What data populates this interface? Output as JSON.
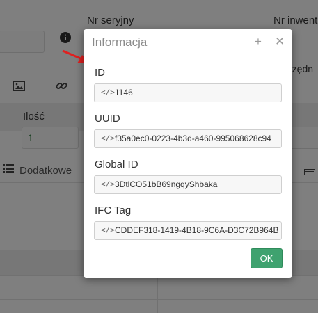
{
  "background": {
    "labels": {
      "serial_number": "Nr seryjny",
      "inventory_number": "Nr inwent",
      "quantity": "Ilość",
      "coordinates_partial": "rzędn",
      "additional": "Dodatkowe"
    },
    "quantity_value": "1"
  },
  "modal": {
    "title": "Informacja",
    "fields": [
      {
        "label": "ID",
        "value": "1146"
      },
      {
        "label": "UUID",
        "value": "f35a0ec0-0223-4b3d-a460-995068628c94"
      },
      {
        "label": "Global ID",
        "value": "3DtlCO51bB69ngqyShbaka"
      },
      {
        "label": "IFC Tag",
        "value": "CDDEF318-1419-4B18-9C6A-D3C72B964B"
      }
    ],
    "ok_label": "OK"
  },
  "colors": {
    "ok_button": "#3fa26f",
    "arrow": "#e02020",
    "info_icon": "#333333"
  }
}
